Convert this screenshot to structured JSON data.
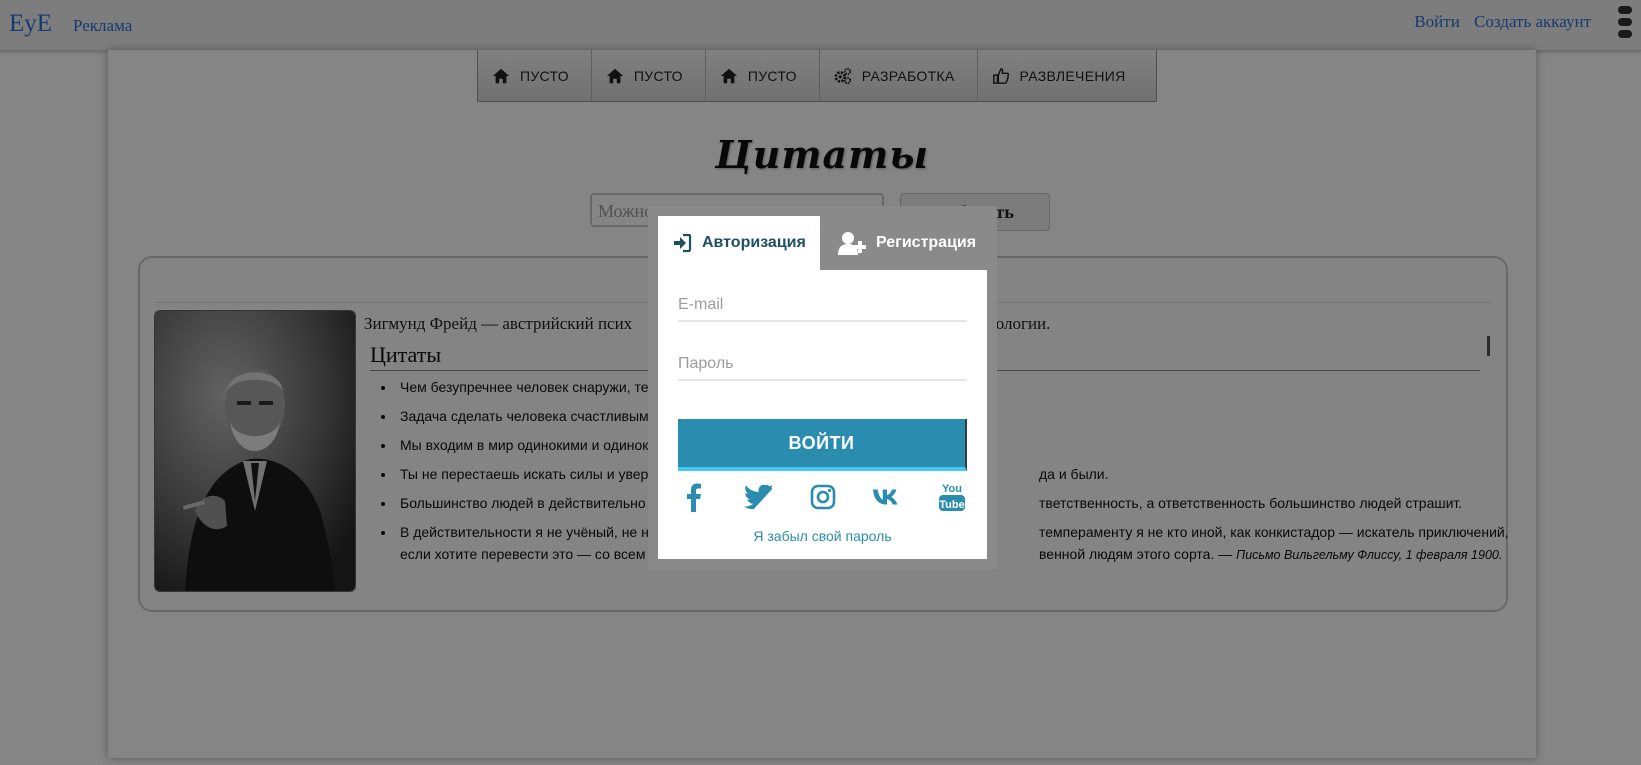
{
  "topbar": {
    "brand": "EyE",
    "ad_link": "Реклама",
    "login_link": "Войти",
    "signup_link": "Создать аккаунт"
  },
  "nav": {
    "items": [
      {
        "label": "ПУСТО",
        "icon": "home-icon"
      },
      {
        "label": "ПУСТО",
        "icon": "home-icon"
      },
      {
        "label": "ПУСТО",
        "icon": "home-icon"
      },
      {
        "label": "РАЗРАБОТКА",
        "icon": "gears-icon"
      },
      {
        "label": "РАЗВЛЕЧЕНИЯ",
        "icon": "thumbs-up-icon"
      }
    ]
  },
  "page": {
    "title": "Цитаты",
    "search_placeholder": "Можно",
    "search_button": "Добавить"
  },
  "card": {
    "bio_start": "Зигмунд Фрейд — австрийский псих",
    "bio_end": "ы в психологии.",
    "quotes_heading": "Цитаты",
    "quotes": [
      {
        "a": "Чем безупречнее человек снаружи, те",
        "b": ""
      },
      {
        "a": "Задача сделать человека счастливым",
        "b": ""
      },
      {
        "a": "Мы входим в мир одинокими и одинок",
        "b": ""
      },
      {
        "a": "Ты не перестаешь искать силы и увер",
        "b": "да и были."
      },
      {
        "a": "Большинство людей в действительно",
        "b": "тветственность, а ответственность большинство людей страшит."
      },
      {
        "a": "В действительности я не учёный, не н",
        "b": "темпераменту я не кто иной, как конкистадор — искатель приключений,",
        "a2": "если хотите перевести это — со всем",
        "b2": "венной людям этого сорта. —",
        "src": "Письмо Вильгельму Флиссу, 1 февраля 1900."
      }
    ]
  },
  "modal": {
    "tab_login": "Авторизация",
    "tab_register": "Регистрация",
    "email_placeholder": "E-mail",
    "password_placeholder": "Пароль",
    "login_button": "ВОЙТИ",
    "socials": [
      "facebook-icon",
      "twitter-icon",
      "instagram-icon",
      "vk-icon",
      "youtube-icon"
    ],
    "forgot": "Я забыл свой пароль"
  },
  "colors": {
    "link": "#2d6fd6",
    "button": "#2a8db0",
    "tab_active_text": "#1f4f63"
  }
}
